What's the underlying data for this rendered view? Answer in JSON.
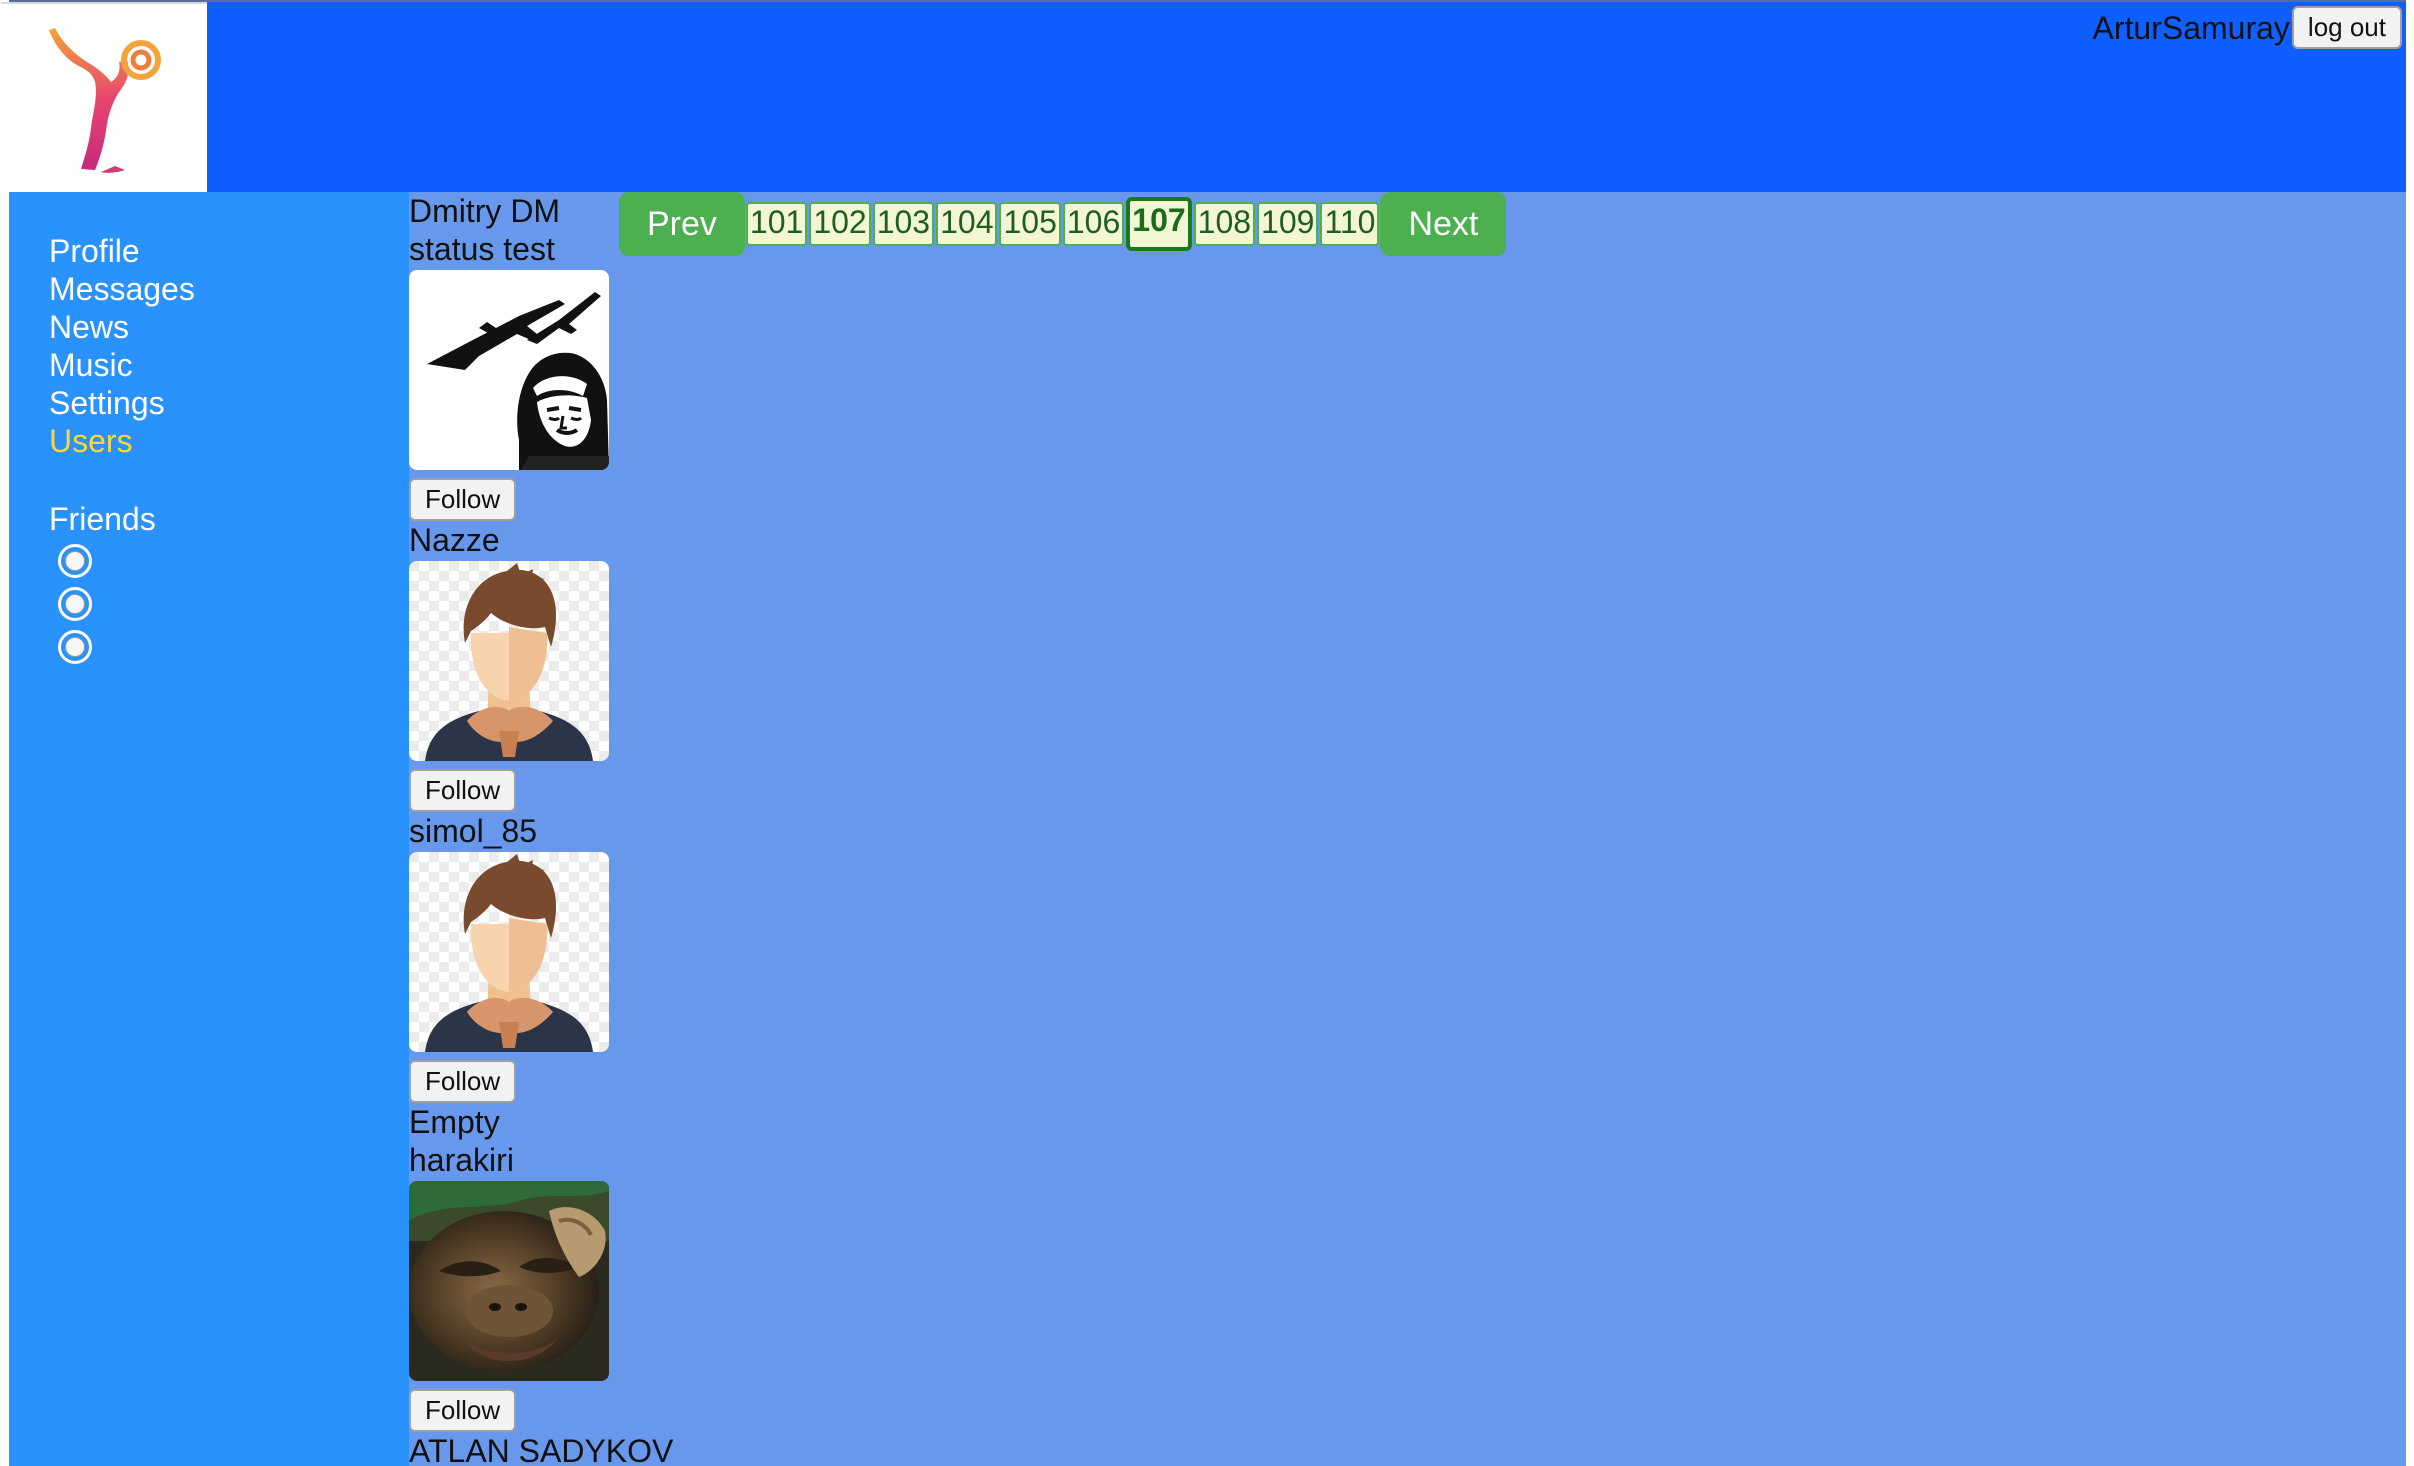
{
  "header": {
    "logo_icon": "dancer-logo-icon",
    "login_name": "ArturSamuray",
    "logout_label": "log out"
  },
  "nav": {
    "items": [
      {
        "label": "Profile",
        "active": false
      },
      {
        "label": "Messages",
        "active": false
      },
      {
        "label": "News",
        "active": false
      },
      {
        "label": "Music",
        "active": false
      },
      {
        "label": "Settings",
        "active": false
      },
      {
        "label": "Users",
        "active": true
      }
    ],
    "friends_title": "Friends",
    "friends_count": 3,
    "active_color": "#ffd533"
  },
  "pagination": {
    "prev_label": "Prev",
    "next_label": "Next",
    "pages": [
      "101",
      "102",
      "103",
      "104",
      "105",
      "106",
      "107",
      "108",
      "109",
      "110"
    ],
    "current": "107"
  },
  "users": [
    {
      "name": "Dmitry DM",
      "status": "status test",
      "avatar": "pilot-plane-icon",
      "follow_label": "Follow"
    },
    {
      "name": "Nazze",
      "status": "",
      "avatar": "default-man-avatar-icon",
      "follow_label": "Follow"
    },
    {
      "name": "simol_85",
      "status": "",
      "avatar": "default-man-avatar-icon",
      "follow_label": "Follow"
    },
    {
      "name": "Empty",
      "status": "harakiri",
      "avatar": "monkey-photo-icon",
      "follow_label": "Follow"
    },
    {
      "name": "ATLAN SADYKOV",
      "status": "",
      "avatar": "",
      "follow_label": ""
    }
  ],
  "colors": {
    "header_bg": "#0f5fff",
    "nav_bg": "#2992fc",
    "content_bg": "#6898eb",
    "pager_green": "#4caf50"
  }
}
